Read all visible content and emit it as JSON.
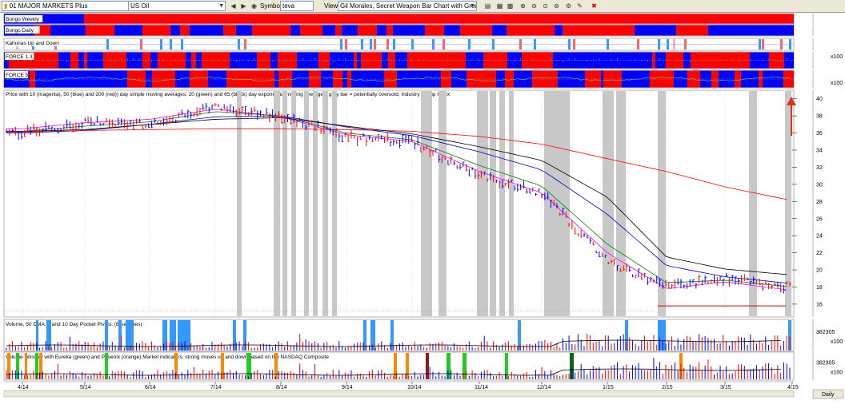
{
  "toolbar": {
    "list_value": "01 MAJOR MARKETS Plus",
    "market_value": "US Oil",
    "symbol_label": "Symbol:",
    "symbol_value": "teva",
    "view_label": "View:",
    "view_value": "Gil Morales, Secret Weapon Bar Chart with Group Index",
    "buttons": [
      "nav-back-icon",
      "nav-forward-icon",
      "gamepad-icon",
      "zoom-in-icon",
      "zoom-out-icon",
      "chart-icon",
      "settings-icon",
      "close-icon"
    ]
  },
  "chart_data": {
    "type": "bar",
    "symbol": "teva",
    "panels": [
      {
        "name": "Bongo Weekly",
        "kind": "color-band"
      },
      {
        "name": "Bongo Daily",
        "kind": "color-band"
      },
      {
        "name": "Kahunas Up and Down",
        "kind": "signal-ticks"
      },
      {
        "name": "FORCE 1.3",
        "kind": "color-band-histogram",
        "axis_label": "x100"
      },
      {
        "name": "FORCE 5",
        "kind": "color-band-oscillator",
        "axis_label": "x100"
      },
      {
        "name": "Price with 10 (magenta), 50 (blue) and 200 (red)) day simple moving averages; 20 (green) and 65 (black) day exponential moving averages; gray bar = potentially oversold, Industry Group Index",
        "kind": "price-ohlc"
      },
      {
        "name": "Volume, 50 DMA, 5 and 10 Day Pocket Pivots: (Blue Lines)",
        "kind": "volume",
        "axis_value": "382305",
        "axis_label": "x100"
      },
      {
        "name": "Volume Window with Eureka (green) and Phoenix (orange) Market indicators, strong moves up and down based on the NASDAQ Composite",
        "kind": "volume",
        "axis_value": "382305",
        "axis_label": "x100"
      }
    ],
    "x_ticks": [
      "4/14",
      "5/14",
      "6/14",
      "7/14",
      "8/14",
      "9/14",
      "10/14",
      "11/14",
      "12/14",
      "1/15",
      "2/15",
      "3/15",
      "4/15"
    ],
    "y_ticks": [
      16,
      18,
      20,
      22,
      24,
      26,
      28,
      30,
      32,
      34,
      36,
      38,
      40
    ],
    "ylim": [
      14.5,
      41
    ],
    "price_series": {
      "name": "Price",
      "x": [
        "4/14",
        "5/14",
        "6/14",
        "7/14",
        "8/14",
        "9/14",
        "10/14",
        "11/14",
        "12/14",
        "1/15",
        "2/15",
        "3/15",
        "4/15"
      ],
      "values": [
        35.9,
        37.3,
        37.0,
        39.0,
        38.0,
        35.5,
        35.0,
        31.0,
        29.0,
        21.0,
        18.0,
        19.0,
        18.0
      ]
    },
    "moving_averages": [
      {
        "color": "#ff00ff",
        "values": [
          36.5,
          37.2,
          37.6,
          38.8,
          37.9,
          35.8,
          35.0,
          31.5,
          29.0,
          22.0,
          17.8,
          18.6,
          17.6
        ]
      },
      {
        "color": "#0000cc",
        "values": [
          36.0,
          36.3,
          37.0,
          37.9,
          38.0,
          36.7,
          35.7,
          33.8,
          31.7,
          26.5,
          20.5,
          19.2,
          18.4
        ]
      },
      {
        "color": "#ff0000",
        "values": [
          36.1,
          36.3,
          36.4,
          36.5,
          36.5,
          36.4,
          36.2,
          35.6,
          34.7,
          33.0,
          31.5,
          29.7,
          28.1
        ]
      },
      {
        "color": "#008000",
        "values": [
          36.2,
          36.8,
          37.3,
          38.5,
          38.0,
          36.0,
          35.2,
          32.2,
          29.8,
          23.0,
          18.5,
          18.8,
          18.0
        ]
      },
      {
        "color": "#000000",
        "values": [
          36.2,
          36.4,
          37.0,
          37.6,
          37.8,
          36.8,
          35.9,
          34.4,
          32.8,
          28.5,
          21.5,
          20.1,
          19.4
        ]
      }
    ],
    "support_line": 15.8,
    "colors": {
      "up_bar": "#0000ff",
      "down_bar": "#ff0000",
      "oversold_bar": "#c8c8c8",
      "band_red": "#ff0000",
      "band_blue": "#0000ff",
      "signal_blue": "#3399ff",
      "eureka": "#22cc22",
      "phoenix": "#ff8800"
    },
    "legend_position": "none"
  },
  "footer": {
    "period_button": "Daily"
  }
}
